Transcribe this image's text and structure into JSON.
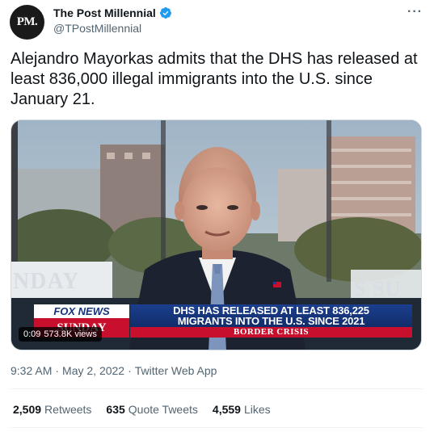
{
  "author": {
    "avatar_text": "PM.",
    "display_name": "The Post Millennial",
    "handle": "@TPostMillennial",
    "verified_color": "#1d9bf0"
  },
  "more_label": "···",
  "tweet": {
    "text": "Alejandro Mayorkas admits that the DHS has released at least 836,000 illegal immigrants into the U.S. since January 21."
  },
  "video": {
    "current_time": "0:09",
    "views": "573.8K views",
    "studio_text_left": "NDAY",
    "studio_text_right": "S SU",
    "bug_top": "FOX NEWS",
    "bug_bottom": "SUNDAY",
    "headline_line1": "DHS HAS RELEASED AT LEAST 836,225",
    "headline_line2": "MIGRANTS INTO THE U.S. SINCE 2021",
    "tag": "BORDER CRISIS"
  },
  "meta": {
    "time": "9:32 AM",
    "date": "May 2, 2022",
    "source": "Twitter Web App",
    "sep": "·"
  },
  "stats": {
    "retweets_count": "2,509",
    "retweets_label": "Retweets",
    "quotes_count": "635",
    "quotes_label": "Quote Tweets",
    "likes_count": "4,559",
    "likes_label": "Likes"
  }
}
